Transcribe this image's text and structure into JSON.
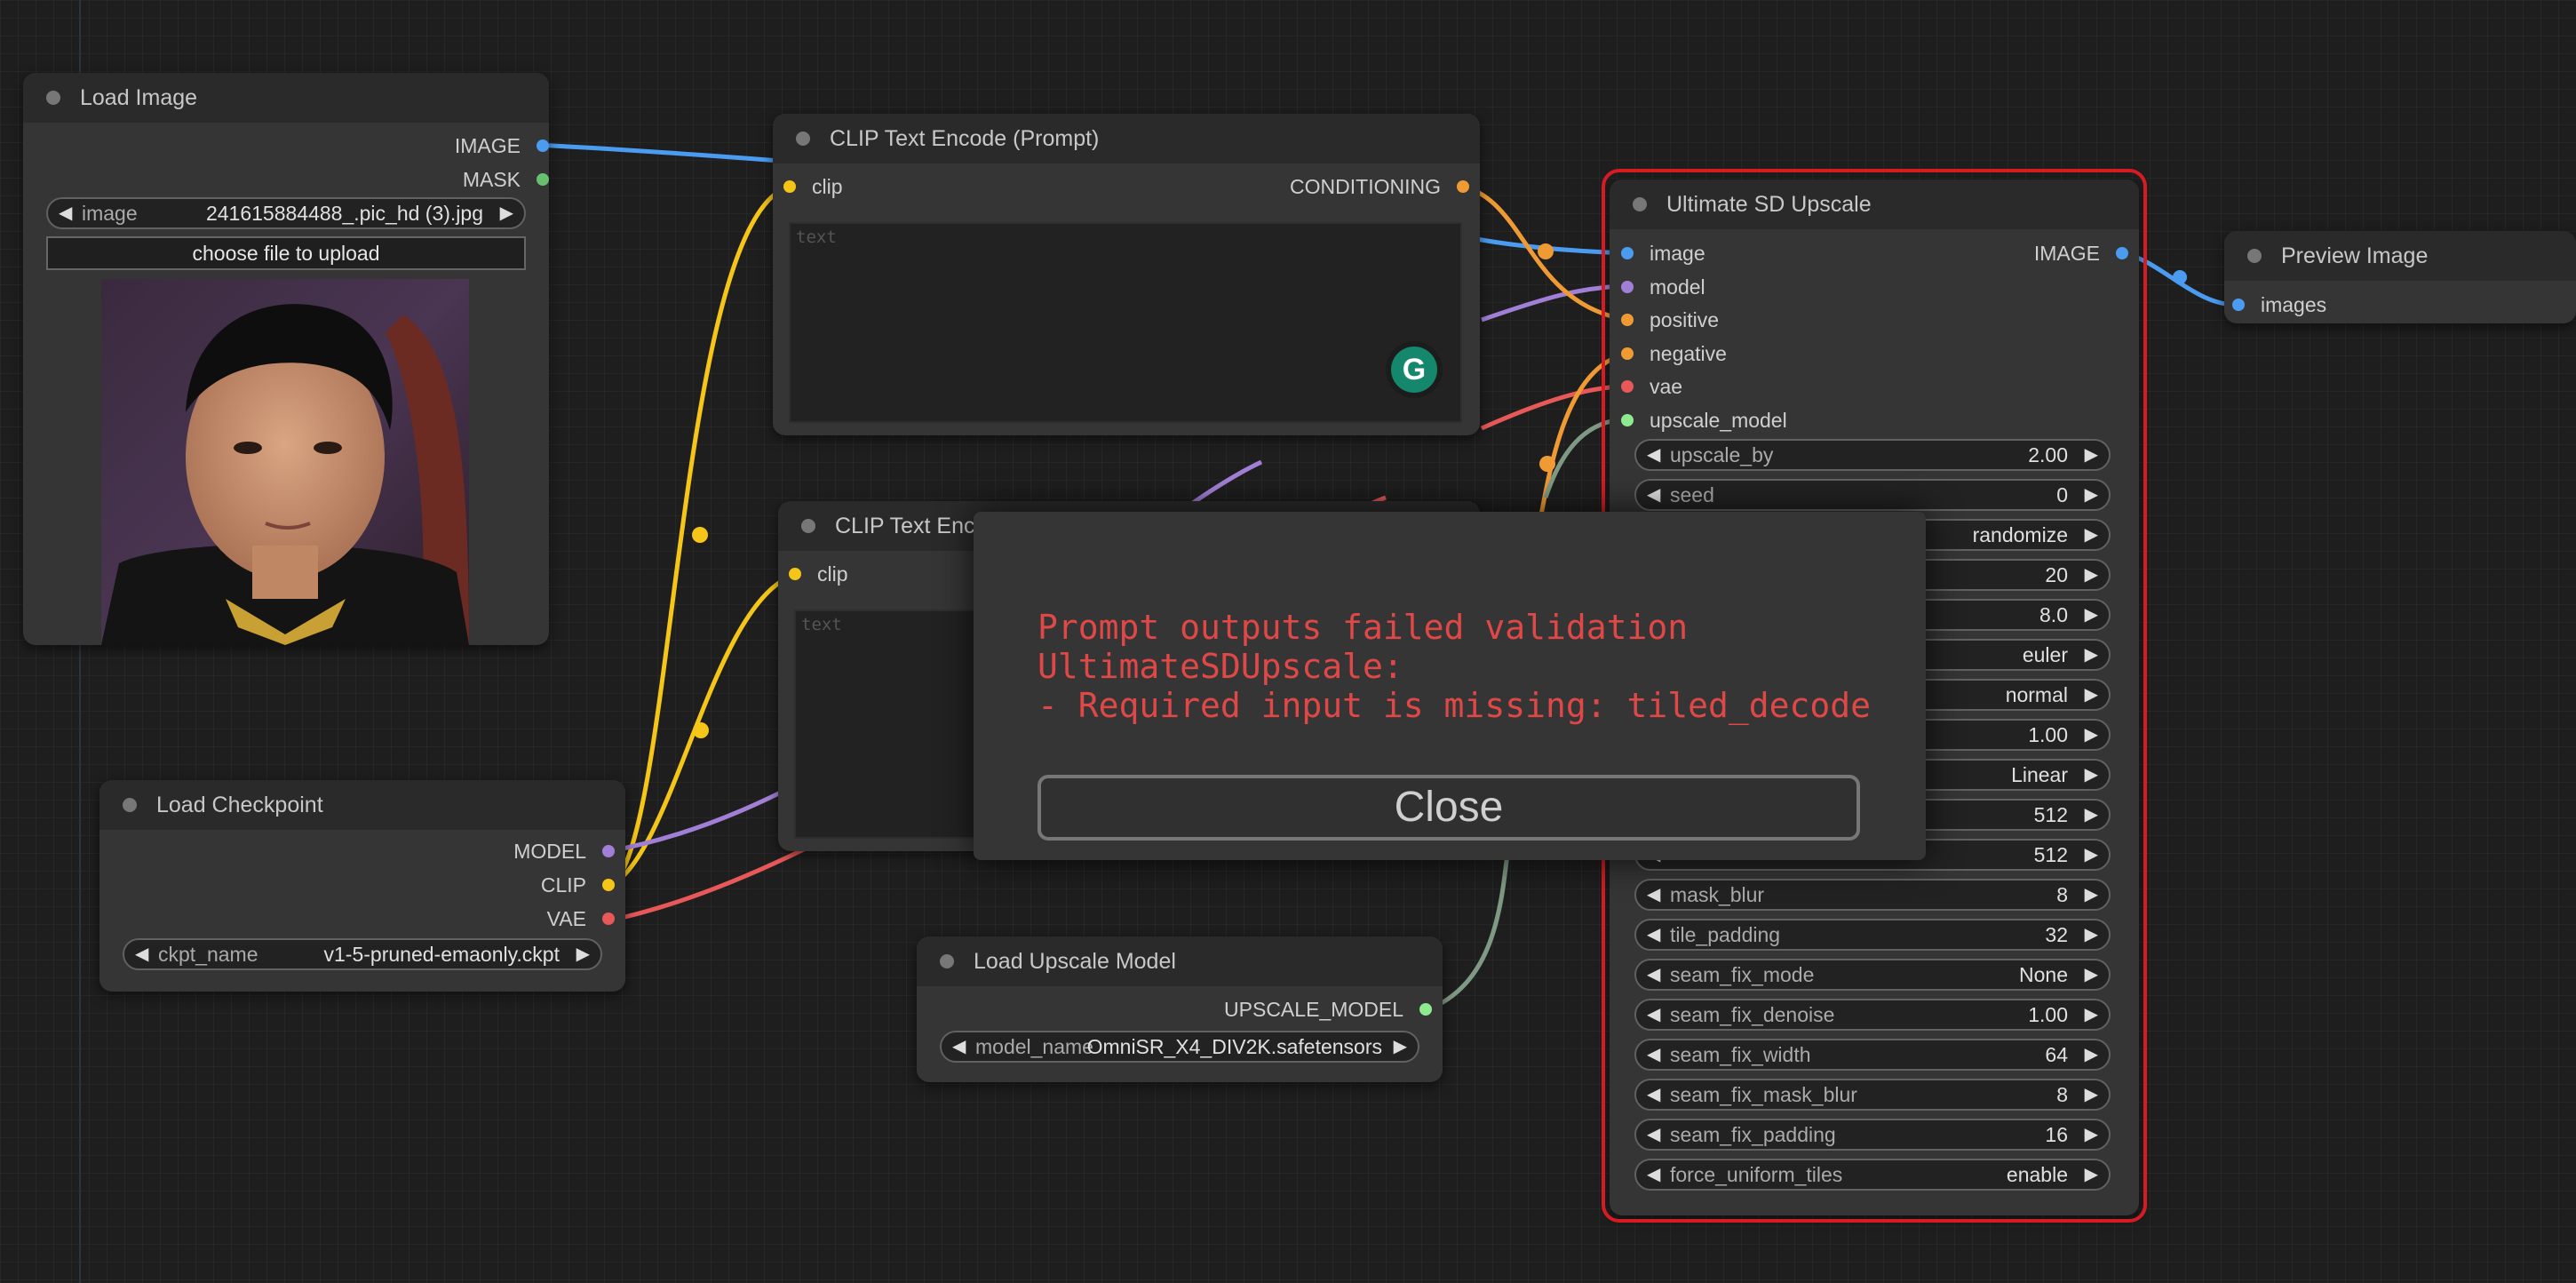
{
  "colors": {
    "image": "#4b9cf0",
    "mask": "#67c070",
    "clip": "#f5c518",
    "conditioning": "#f09a34",
    "model": "#a27fd6",
    "vae": "#e85858",
    "upscale_model": "#8eea8e",
    "error": "#e04848",
    "highlight": "#d71b22"
  },
  "load_image": {
    "title": "Load Image",
    "out_image": "IMAGE",
    "out_mask": "MASK",
    "image_label": "image",
    "image_value": "241615884488_.pic_hd (3).jpg",
    "upload_label": "choose file to upload"
  },
  "clip_pos": {
    "title": "CLIP Text Encode (Prompt)",
    "in_clip": "clip",
    "out_cond": "CONDITIONING",
    "placeholder": "text",
    "assistant_icon": "G"
  },
  "clip_neg": {
    "title": "CLIP Text Enc",
    "in_clip": "clip",
    "placeholder": "text"
  },
  "load_checkpoint": {
    "title": "Load Checkpoint",
    "out_model": "MODEL",
    "out_clip": "CLIP",
    "out_vae": "VAE",
    "ckpt_label": "ckpt_name",
    "ckpt_value": "v1-5-pruned-emaonly.ckpt"
  },
  "load_upscale": {
    "title": "Load Upscale Model",
    "out": "UPSCALE_MODEL",
    "model_label": "model_name",
    "model_value": "OmniSR_X4_DIV2K.safetensors"
  },
  "usdu": {
    "title": "Ultimate SD Upscale",
    "inputs": [
      "image",
      "model",
      "positive",
      "negative",
      "vae",
      "upscale_model"
    ],
    "output": "IMAGE",
    "widgets": [
      {
        "label": "upscale_by",
        "value": "2.00"
      },
      {
        "label": "seed",
        "value": "0"
      },
      {
        "label": "",
        "value": "randomize"
      },
      {
        "label": "",
        "value": "20"
      },
      {
        "label": "",
        "value": "8.0"
      },
      {
        "label": "",
        "value": "euler"
      },
      {
        "label": "",
        "value": "normal"
      },
      {
        "label": "",
        "value": "1.00"
      },
      {
        "label": "",
        "value": "Linear"
      },
      {
        "label": "",
        "value": "512"
      },
      {
        "label": "",
        "value": "512"
      },
      {
        "label": "mask_blur",
        "value": "8"
      },
      {
        "label": "tile_padding",
        "value": "32"
      },
      {
        "label": "seam_fix_mode",
        "value": "None"
      },
      {
        "label": "seam_fix_denoise",
        "value": "1.00"
      },
      {
        "label": "seam_fix_width",
        "value": "64"
      },
      {
        "label": "seam_fix_mask_blur",
        "value": "8"
      },
      {
        "label": "seam_fix_padding",
        "value": "16"
      },
      {
        "label": "force_uniform_tiles",
        "value": "enable"
      }
    ]
  },
  "preview": {
    "title": "Preview Image",
    "in_images": "images"
  },
  "modal": {
    "message": "Prompt outputs failed validation\nUltimateSDUpscale:\n- Required input is missing: tiled_decode",
    "close_label": "Close"
  }
}
